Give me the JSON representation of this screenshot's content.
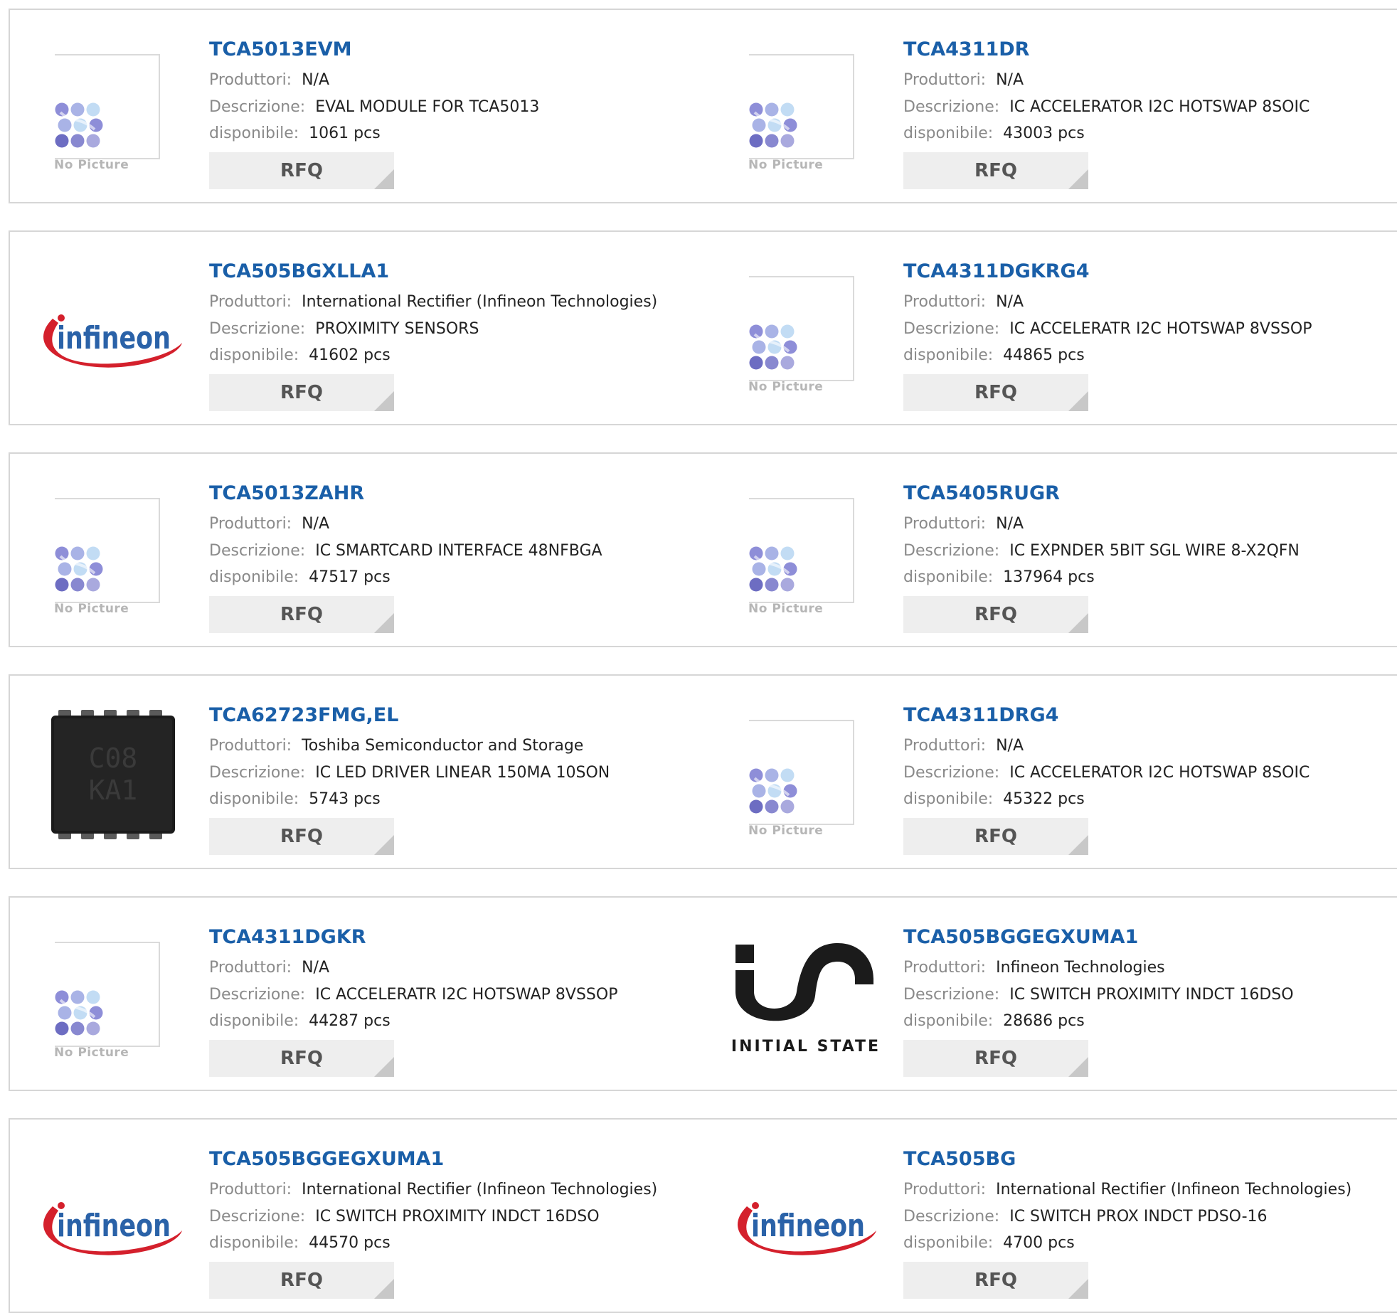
{
  "labels": {
    "manufacturer": "Produttori:",
    "description": "Descrizione:",
    "available": "disponibile:",
    "rfq": "RFQ",
    "no_picture": "No Picture"
  },
  "brand_images": {
    "infineon_text": "infineon",
    "initial_state_text": "INITIAL STATE",
    "chip_marking_1": "C08",
    "chip_marking_2": "KA1"
  },
  "colors": {
    "title": "#1a5fa8",
    "label": "#8a8a8a",
    "value": "#222222",
    "rfq_bg": "#eeeeee",
    "border": "#d6d6d6",
    "infineon_blue": "#2a62a8",
    "infineon_red": "#d4202c"
  },
  "products": [
    {
      "part": "TCA5013EVM",
      "manufacturer": "N/A",
      "description": "EVAL MODULE FOR TCA5013",
      "available": "1061 pcs",
      "image": "no-picture"
    },
    {
      "part": "TCA4311DR",
      "manufacturer": "N/A",
      "description": "IC ACCELERATOR I2C HOTSWAP 8SOIC",
      "available": "43003 pcs",
      "image": "no-picture"
    },
    {
      "part": "TCA505BGXLLA1",
      "manufacturer": "International Rectifier (Infineon Technologies)",
      "description": "PROXIMITY SENSORS",
      "available": "41602 pcs",
      "image": "infineon-logo"
    },
    {
      "part": "TCA4311DGKRG4",
      "manufacturer": "N/A",
      "description": "IC ACCELERATR I2C HOTSWAP 8VSSOP",
      "available": "44865 pcs",
      "image": "no-picture"
    },
    {
      "part": "TCA5013ZAHR",
      "manufacturer": "N/A",
      "description": "IC SMARTCARD INTERFACE 48NFBGA",
      "available": "47517 pcs",
      "image": "no-picture"
    },
    {
      "part": "TCA5405RUGR",
      "manufacturer": "N/A",
      "description": "IC EXPNDER 5BIT SGL WIRE 8-X2QFN",
      "available": "137964 pcs",
      "image": "no-picture"
    },
    {
      "part": "TCA62723FMG,EL",
      "manufacturer": "Toshiba Semiconductor and Storage",
      "description": "IC LED DRIVER LINEAR 150MA 10SON",
      "available": "5743 pcs",
      "image": "chip-photo"
    },
    {
      "part": "TCA4311DRG4",
      "manufacturer": "N/A",
      "description": "IC ACCELERATOR I2C HOTSWAP 8SOIC",
      "available": "45322 pcs",
      "image": "no-picture"
    },
    {
      "part": "TCA4311DGKR",
      "manufacturer": "N/A",
      "description": "IC ACCELERATR I2C HOTSWAP 8VSSOP",
      "available": "44287 pcs",
      "image": "no-picture"
    },
    {
      "part": "TCA505BGGEGXUMA1",
      "manufacturer": "Infineon Technologies",
      "description": "IC SWITCH PROXIMITY INDCT 16DSO",
      "available": "28686 pcs",
      "image": "initial-state-logo"
    },
    {
      "part": "TCA505BGGEGXUMA1",
      "manufacturer": "International Rectifier (Infineon Technologies)",
      "description": "IC SWITCH PROXIMITY INDCT 16DSO",
      "available": "44570 pcs",
      "image": "infineon-logo"
    },
    {
      "part": "TCA505BG",
      "manufacturer": "International Rectifier (Infineon Technologies)",
      "description": "IC SWITCH PROX INDCT PDSO-16",
      "available": "4700 pcs",
      "image": "infineon-logo"
    }
  ]
}
